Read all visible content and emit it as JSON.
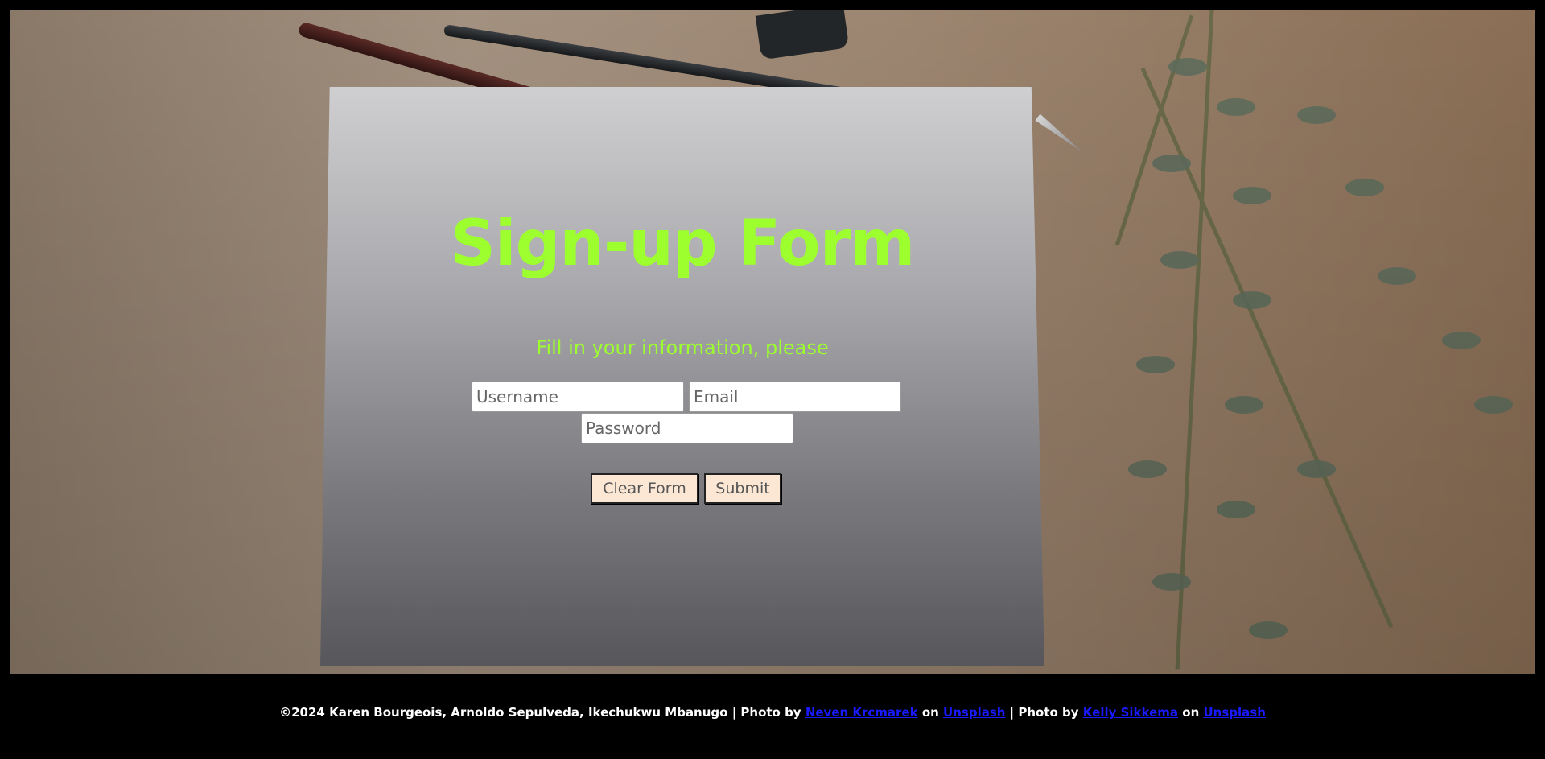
{
  "form": {
    "title": "Sign-up Form",
    "subtitle": "Fill in your information, please",
    "username_placeholder": "Username",
    "email_placeholder": "Email",
    "password_placeholder": "Password",
    "clear_label": "Clear Form",
    "submit_label": "Submit"
  },
  "footer": {
    "copyright": "©2024 Karen Bourgeois, Arnoldo Sepulveda, Ikechukwu Mbanugo",
    "separator": " | Photo by ",
    "photographer1": "Neven Krcmarek",
    "on": " on ",
    "site1": "Unsplash",
    "separator2": " | Photo by ",
    "photographer2": "Kelly Sikkema",
    "on2": " on ",
    "site2": "Unsplash"
  },
  "colors": {
    "accent": "#9dff2e",
    "button_bg": "#fbe7d4",
    "link": "#1a1aff",
    "footer_bg": "#000000"
  }
}
